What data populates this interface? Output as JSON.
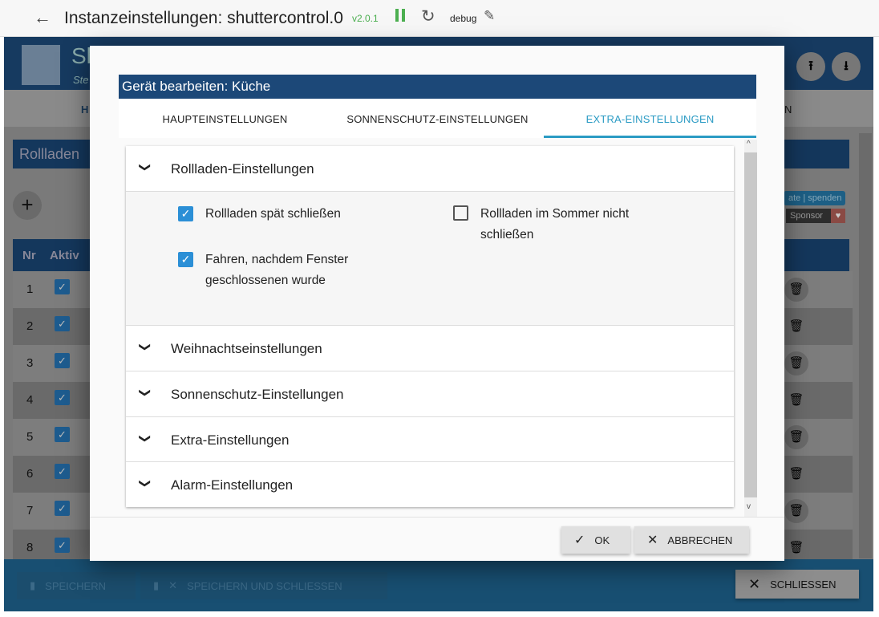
{
  "topbar": {
    "title": "Instanzeinstellungen: shuttercontrol.0",
    "version": "v2.0.1",
    "log_level": "debug"
  },
  "background": {
    "app_title": "Sh",
    "app_subtitle": "Ste",
    "tab_partial_left": "H",
    "tab_partial_right": "N",
    "section_title": "Rollladen",
    "donate": "ate | spenden",
    "sponsor": "Sponsor",
    "table_headers": [
      "Nr",
      "Aktiv"
    ],
    "rows": [
      "1",
      "2",
      "3",
      "4",
      "5",
      "6",
      "7",
      "8"
    ],
    "save": "SPEICHERN",
    "save_close": "SPEICHERN UND SCHLIESSEN",
    "close": "SCHLIESSEN"
  },
  "dialog": {
    "title": "Gerät bearbeiten: Küche",
    "tabs": [
      "HAUPTEINSTELLUNGEN",
      "SONNENSCHUTZ-EINSTELLUNGEN",
      "EXTRA-EINSTELLUNGEN"
    ],
    "active_tab": 2,
    "sections": [
      "Rollladen-Einstellungen",
      "Weihnachtseinstellungen",
      "Sonnenschutz-Einstellungen",
      "Extra-Einstellungen",
      "Alarm-Einstellungen"
    ],
    "checkboxes": [
      {
        "label": "Rollladen spät schließen",
        "checked": true
      },
      {
        "label": "Fahren, nachdem Fenster geschlossenen wurde",
        "checked": true
      },
      {
        "label": "Rollladen im Sommer nicht schließen",
        "checked": false
      }
    ],
    "ok": "OK",
    "cancel": "ABBRECHEN"
  },
  "colors": {
    "accent": "#2b9bc4",
    "header": "#1c4878",
    "check": "#2b8fd6"
  }
}
